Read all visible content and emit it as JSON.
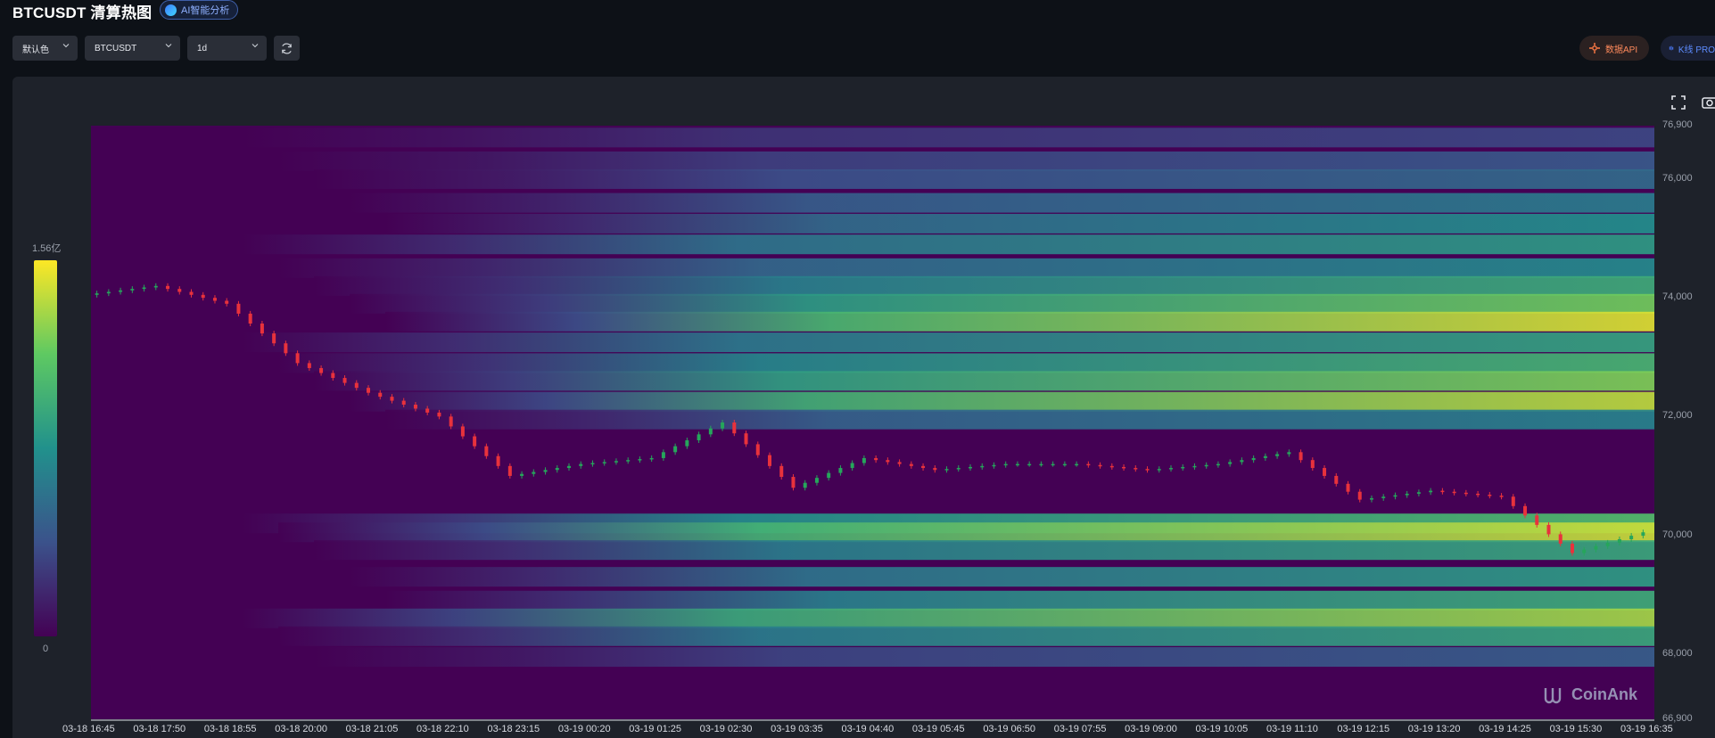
{
  "header": {
    "title": "BTCUSDT 清算热图",
    "ai_badge_label": "AI智能分析"
  },
  "toolbar": {
    "color_scheme": "默认色",
    "symbol": "BTCUSDT",
    "range": "1d",
    "api_label": "数据API",
    "kline_label": "K线 PRO"
  },
  "colors": {
    "background": "#0d1117",
    "panel": "#1e222a",
    "heat_low": "#440154",
    "heat_mid": "#21918c",
    "heat_high": "#fde725",
    "candle_up": "#26a65b",
    "candle_down": "#e8323c"
  },
  "icons": {
    "fullscreen": "fullscreen-icon",
    "camera": "camera-icon",
    "refresh": "refresh-icon",
    "logo": "coinank-logo-icon"
  },
  "chart_data": {
    "type": "heatmap",
    "title": "",
    "xlabel": "",
    "ylabel": "",
    "ylim": [
      66900,
      76900
    ],
    "colorbar": {
      "max_label": "1.56亿",
      "min_label": "0"
    },
    "y_ticks": [
      "76,900",
      "76,000",
      "74,000",
      "72,000",
      "70,000",
      "68,000",
      "66,900"
    ],
    "x_ticks": [
      "03-18 16:45",
      "03-18 17:50",
      "03-18 18:55",
      "03-18 20:00",
      "03-18 21:05",
      "03-18 22:10",
      "03-18 23:15",
      "03-19 00:20",
      "03-19 01:25",
      "03-19 02:30",
      "03-19 03:35",
      "03-19 04:40",
      "03-19 05:45",
      "03-19 06:50",
      "03-19 07:55",
      "03-19 09:00",
      "03-19 10:05",
      "03-19 11:10",
      "03-19 12:15",
      "03-19 13:20",
      "03-19 14:25",
      "03-19 15:30",
      "03-19 16:35"
    ],
    "price_series": {
      "name": "",
      "x": [
        "03-18 16:45",
        "03-18 17:50",
        "03-18 18:55",
        "03-18 20:00",
        "03-18 21:05",
        "03-18 22:10",
        "03-18 23:15",
        "03-19 00:20",
        "03-19 01:25",
        "03-19 02:30",
        "03-19 03:35",
        "03-19 04:40",
        "03-19 05:45",
        "03-19 06:50",
        "03-19 07:55",
        "03-19 09:00",
        "03-19 10:05",
        "03-19 11:10",
        "03-19 12:15",
        "03-19 13:20",
        "03-19 14:25",
        "03-19 15:30",
        "03-19 16:35"
      ],
      "values": [
        74050,
        74200,
        73900,
        72900,
        72400,
        72000,
        71000,
        71200,
        71300,
        71900,
        70800,
        71300,
        71100,
        71200,
        71200,
        71100,
        71200,
        71400,
        70600,
        70750,
        70650,
        69700,
        70050
      ]
    },
    "bands": [
      {
        "price": 76700,
        "intensity": 0.22
      },
      {
        "price": 76300,
        "intensity": 0.28
      },
      {
        "price": 76000,
        "intensity": 0.35
      },
      {
        "price": 75600,
        "intensity": 0.42
      },
      {
        "price": 75250,
        "intensity": 0.5
      },
      {
        "price": 74900,
        "intensity": 0.55
      },
      {
        "price": 74500,
        "intensity": 0.48
      },
      {
        "price": 74200,
        "intensity": 0.62
      },
      {
        "price": 73900,
        "intensity": 0.78
      },
      {
        "price": 73600,
        "intensity": 0.95
      },
      {
        "price": 73250,
        "intensity": 0.58
      },
      {
        "price": 72900,
        "intensity": 0.66
      },
      {
        "price": 72600,
        "intensity": 0.8
      },
      {
        "price": 72250,
        "intensity": 0.9
      },
      {
        "price": 71950,
        "intensity": 0.45
      },
      {
        "price": 70200,
        "intensity": 0.7
      },
      {
        "price": 70050,
        "intensity": 0.92
      },
      {
        "price": 69750,
        "intensity": 0.6
      },
      {
        "price": 69300,
        "intensity": 0.55
      },
      {
        "price": 68900,
        "intensity": 0.62
      },
      {
        "price": 68600,
        "intensity": 0.86
      },
      {
        "price": 68300,
        "intensity": 0.6
      },
      {
        "price": 67950,
        "intensity": 0.3
      }
    ]
  },
  "watermark": "CoinAnk"
}
